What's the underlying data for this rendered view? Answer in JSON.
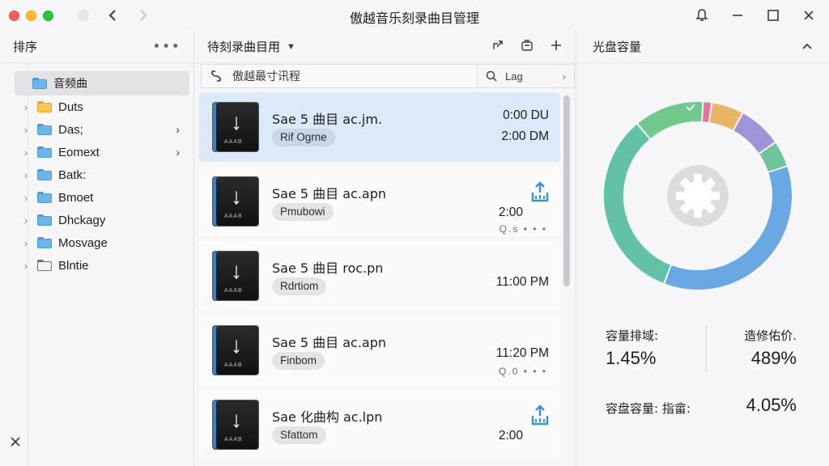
{
  "window": {
    "title": "傲越音乐刻录曲目管理"
  },
  "sidebar": {
    "header": "排序",
    "more_label": "•••",
    "root": "音频曲",
    "items": [
      {
        "label": "Duts",
        "folder": "yellow",
        "has_arrow": false
      },
      {
        "label": "Das;",
        "folder": "blue",
        "has_arrow": true
      },
      {
        "label": "Eomext",
        "folder": "blue",
        "has_arrow": true
      },
      {
        "label": "Batk:",
        "folder": "blue",
        "has_arrow": false
      },
      {
        "label": "Bmoet",
        "folder": "blue",
        "has_arrow": false
      },
      {
        "label": "Dhckagy",
        "folder": "blue",
        "has_arrow": false
      },
      {
        "label": "Mosvage",
        "folder": "blue",
        "has_arrow": false
      },
      {
        "label": "Blntie",
        "folder": "outline",
        "has_arrow": false
      }
    ]
  },
  "list": {
    "title": "待刻录曲目用",
    "filter_label": "傲越最寸讯程",
    "search_label": "Lag",
    "tracks": [
      {
        "name": "Sae 5 曲目 ac.jm.",
        "tag": "Rif Ogrne",
        "time": "0:00 DU",
        "time2": "2:00 DM",
        "sub": "",
        "upload": false,
        "selected": true
      },
      {
        "name": "Sae 5 曲目 ac.apn",
        "tag": "Pmubowi",
        "time": "2:00",
        "time2": "",
        "sub": "Q.s • • •",
        "upload": true,
        "selected": false
      },
      {
        "name": "Sae 5 曲目 roc.pn",
        "tag": "Rdrtiom",
        "time": "11:00 PM",
        "time2": "",
        "sub": "",
        "upload": false,
        "selected": false
      },
      {
        "name": "Sae 5 曲目 ac.apn",
        "tag": "Finbom",
        "time": "11:20 PM",
        "time2": "",
        "sub": "Q.0 • • •",
        "upload": false,
        "selected": false
      },
      {
        "name": "Sae 化曲构 ac.lpn",
        "tag": "Sfattom",
        "time": "2:00",
        "time2": "",
        "sub": "",
        "upload": true,
        "selected": false
      }
    ]
  },
  "capacity": {
    "title": "光盘容量",
    "stats": {
      "label1": "容量排域:",
      "value1": "1.45%",
      "label2": "造修佑价.",
      "value2": "489%",
      "label3": "容盘容量: 指畲:",
      "value3": "4.05%"
    },
    "segments": [
      {
        "color": "#6aa8e3",
        "share": 0.36
      },
      {
        "color": "#62c2a8",
        "share": 0.33
      },
      {
        "color": "#72c98e",
        "share": 0.12
      },
      {
        "color": "#e8719f",
        "share": 0.015
      },
      {
        "color": "#e8b465",
        "share": 0.055
      },
      {
        "color": "#9d95d6",
        "share": 0.075
      },
      {
        "color": "#6ec59c",
        "share": 0.045
      }
    ]
  }
}
